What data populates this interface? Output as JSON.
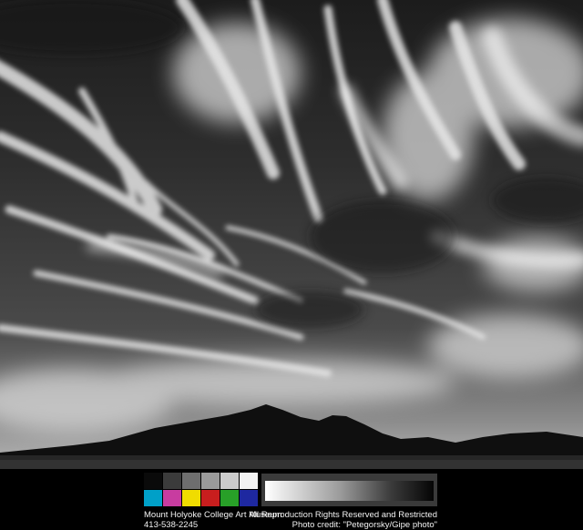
{
  "image": {
    "subject": "black-and-white photograph of streaked cirrus clouds over a desert mountain silhouette"
  },
  "color_bar": {
    "top_row": [
      "#0a0a0a",
      "#3b3b3b",
      "#6e6e6e",
      "#9a9a9a",
      "#cbcbcb",
      "#f2f2f2"
    ],
    "bottom_row": [
      "#00a0c8",
      "#c83ca0",
      "#f0dc00",
      "#c81e1e",
      "#28a028",
      "#1e28a0"
    ]
  },
  "captions": {
    "institution": "Mount Holyoke College Art Museum",
    "phone": "413-538-2245",
    "rights": "All Reproduction Rights Reserved and Restricted",
    "credit": "Photo credit: \"Petegorsky/Gipe photo\""
  }
}
